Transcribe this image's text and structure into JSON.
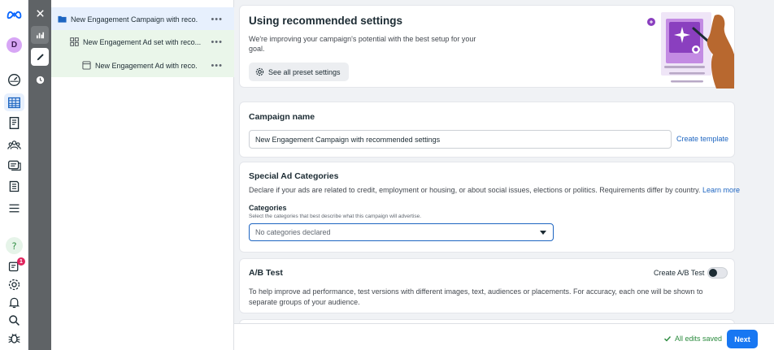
{
  "rail": {
    "avatar_initial": "D",
    "notification_count": "1",
    "icons": [
      "meta-logo-icon",
      "avatar",
      "dashboard-icon",
      "ads-manager-icon",
      "pages-icon",
      "audiences-icon",
      "campaigns-icon",
      "billing-icon",
      "menu-icon",
      "help-icon",
      "notifications-icon",
      "settings-icon",
      "bell-icon",
      "search-icon",
      "bug-icon"
    ]
  },
  "strip": {
    "buttons": [
      "close-icon",
      "chart-icon",
      "edit-icon",
      "history-icon"
    ],
    "selected": "edit-icon"
  },
  "tree": {
    "campaign": "New Engagement Campaign with reco...",
    "adset": "New Engagement Ad set with reco...",
    "ad": "New Engagement Ad with reco...",
    "more": "•••"
  },
  "recommended": {
    "title": "Using recommended settings",
    "description": "We're improving your campaign's potential with the best setup for your goal.",
    "button": "See all preset settings"
  },
  "campaign_name": {
    "heading": "Campaign name",
    "value": "New Engagement Campaign with recommended settings",
    "create_template": "Create template"
  },
  "special_ad_categories": {
    "heading": "Special Ad Categories",
    "description": "Declare if your ads are related to credit, employment or housing, or about social issues, elections or politics. Requirements differ by country.",
    "learn_more": "Learn more",
    "categories_label": "Categories",
    "categories_help": "Select the categories that best describe what this campaign will advertise.",
    "select_value": "No categories declared"
  },
  "ab_test": {
    "heading": "A/B Test",
    "toggle_label": "Create A/B Test",
    "toggle_on": false,
    "description": "To help improve ad performance, test versions with different images, text, audiences or placements. For accuracy, each one will be shown to separate groups of your audience."
  },
  "footer": {
    "saved": "All edits saved",
    "next": "Next"
  },
  "colors": {
    "accent": "#1877f2",
    "link": "#1d65c1",
    "saved_green": "#2b8b3e",
    "tree_selected": "#e7f0fd",
    "tree_child": "#eaf6ea"
  }
}
